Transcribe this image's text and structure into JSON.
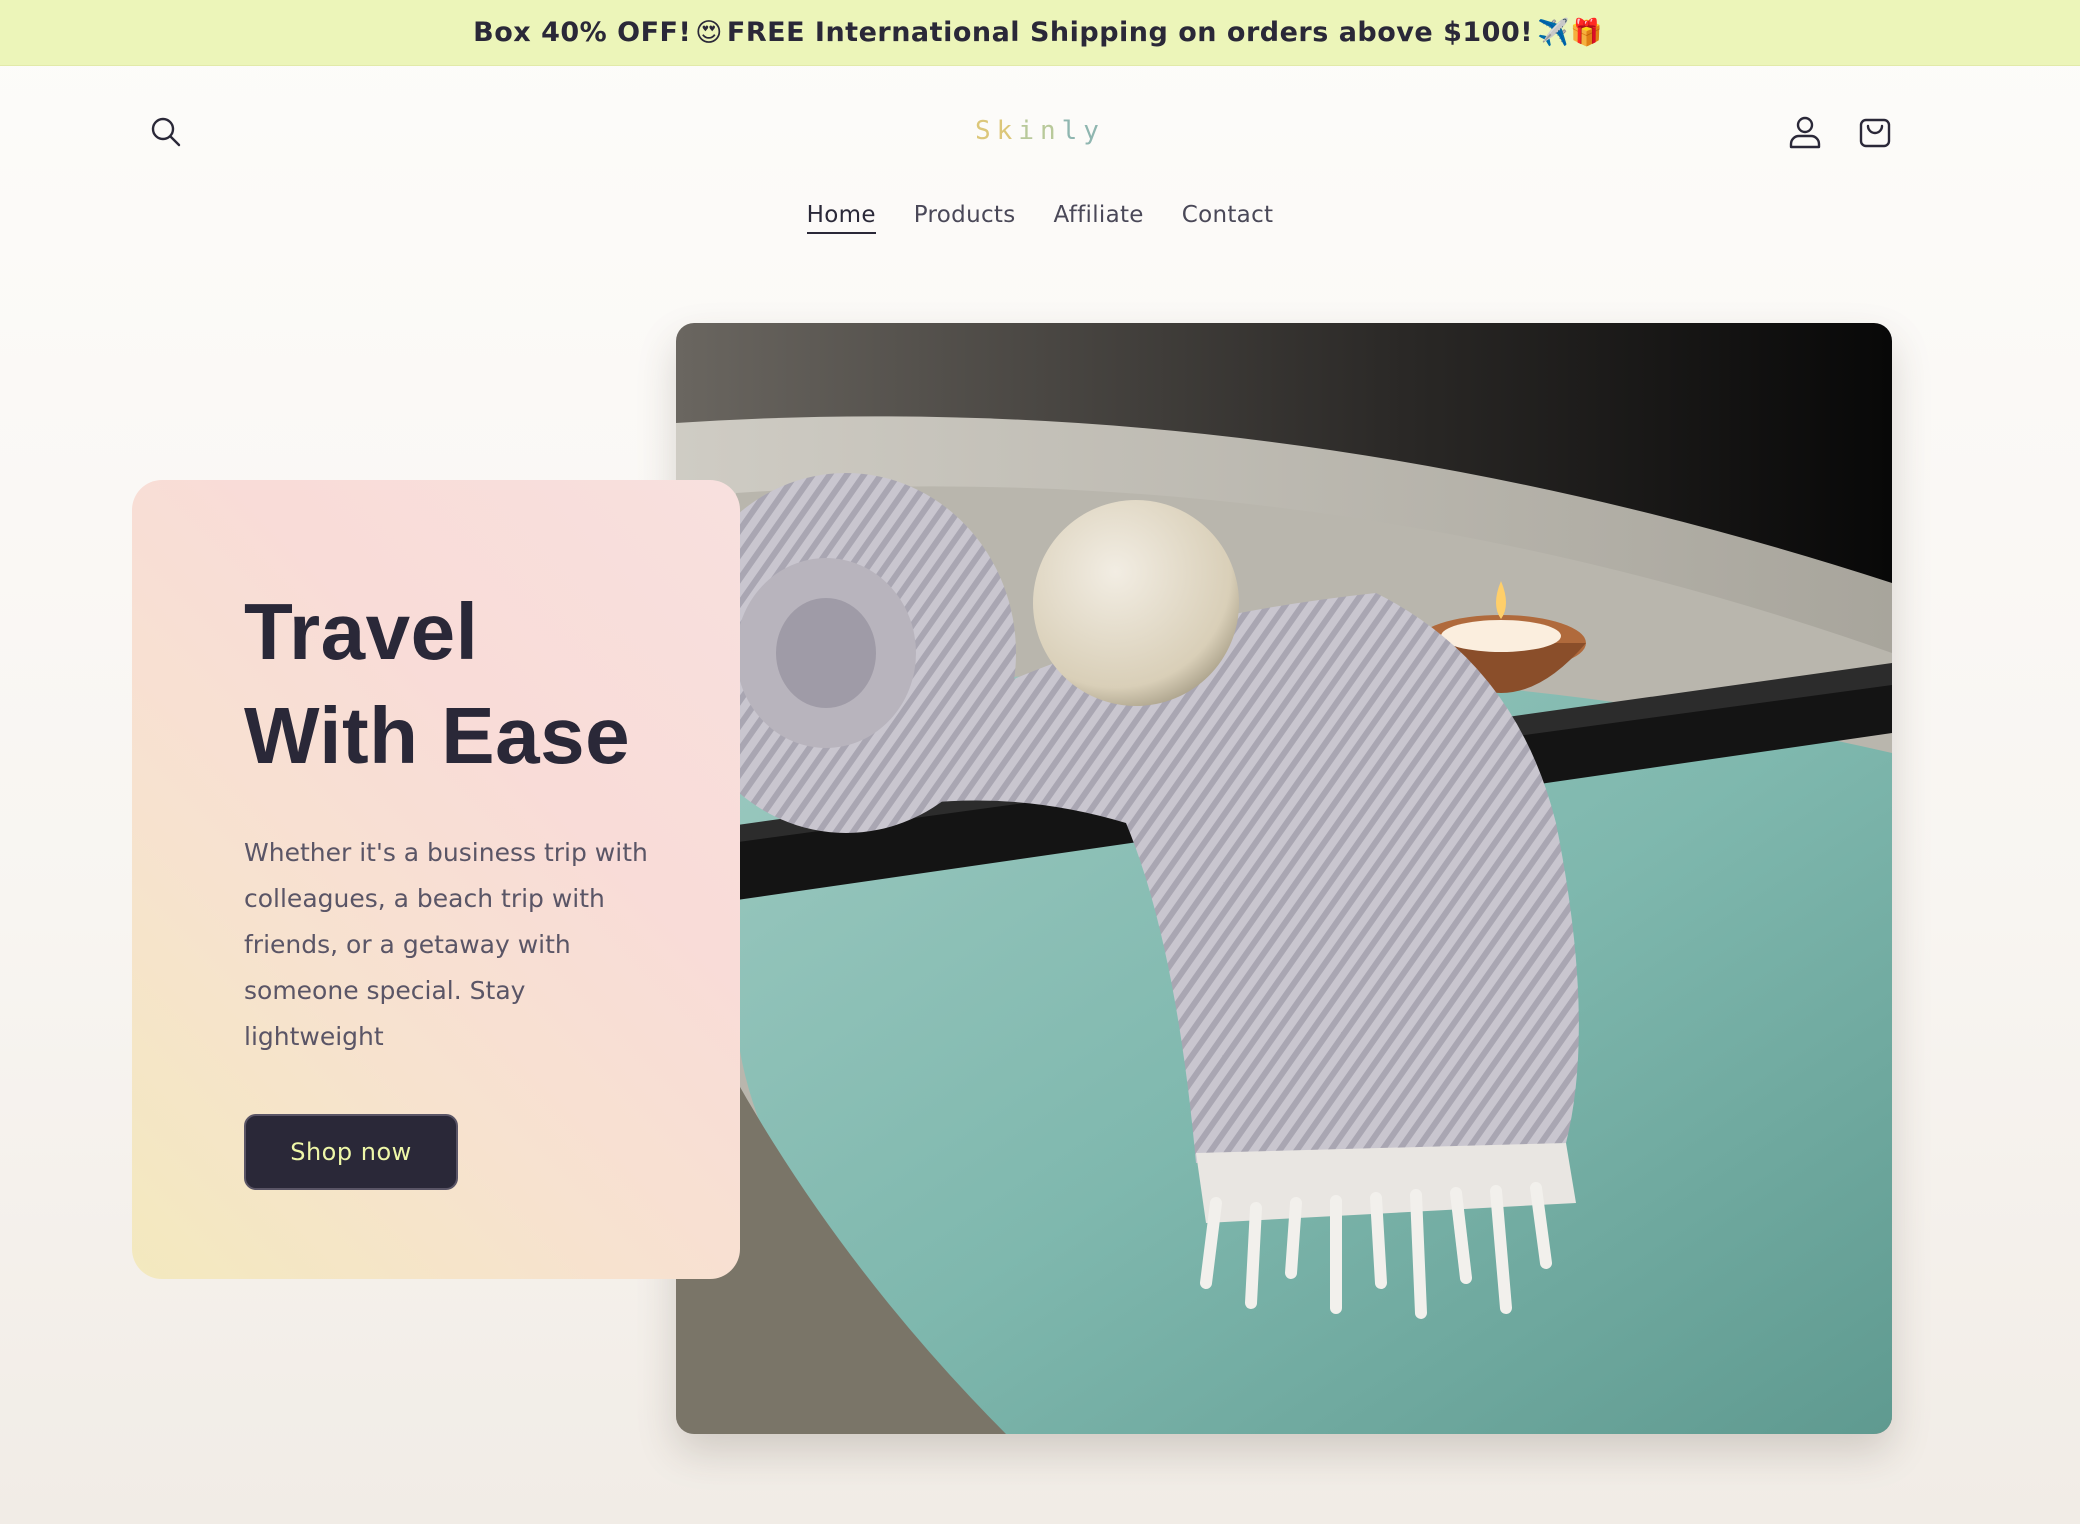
{
  "announcement": {
    "text_1": "Box 40% OFF!",
    "emoji_1": "😍",
    "text_2": "FREE International Shipping on orders above $100!",
    "emoji_2": "✈️🎁"
  },
  "header": {
    "logo": {
      "part1": "Sk",
      "part2": "in",
      "part3": "ly"
    },
    "nav": [
      {
        "label": "Home",
        "active": true
      },
      {
        "label": "Products"
      },
      {
        "label": "Affiliate"
      },
      {
        "label": "Contact"
      }
    ],
    "icons": [
      "search-icon",
      "account-icon",
      "cart-icon"
    ]
  },
  "hero": {
    "title_line1": "Travel",
    "title_line2": "With Ease",
    "description": "Whether it's a business trip with colleagues, a beach trip with friends, or a getaway with someone special. Stay lightweight",
    "cta_label": "Shop now"
  },
  "colors": {
    "announcement_bg": "#ecf5b9",
    "text_dark": "#2a2838",
    "button_text": "#eef7a8",
    "card_start": "#f3e9be",
    "card_end": "#f9dcd8"
  }
}
